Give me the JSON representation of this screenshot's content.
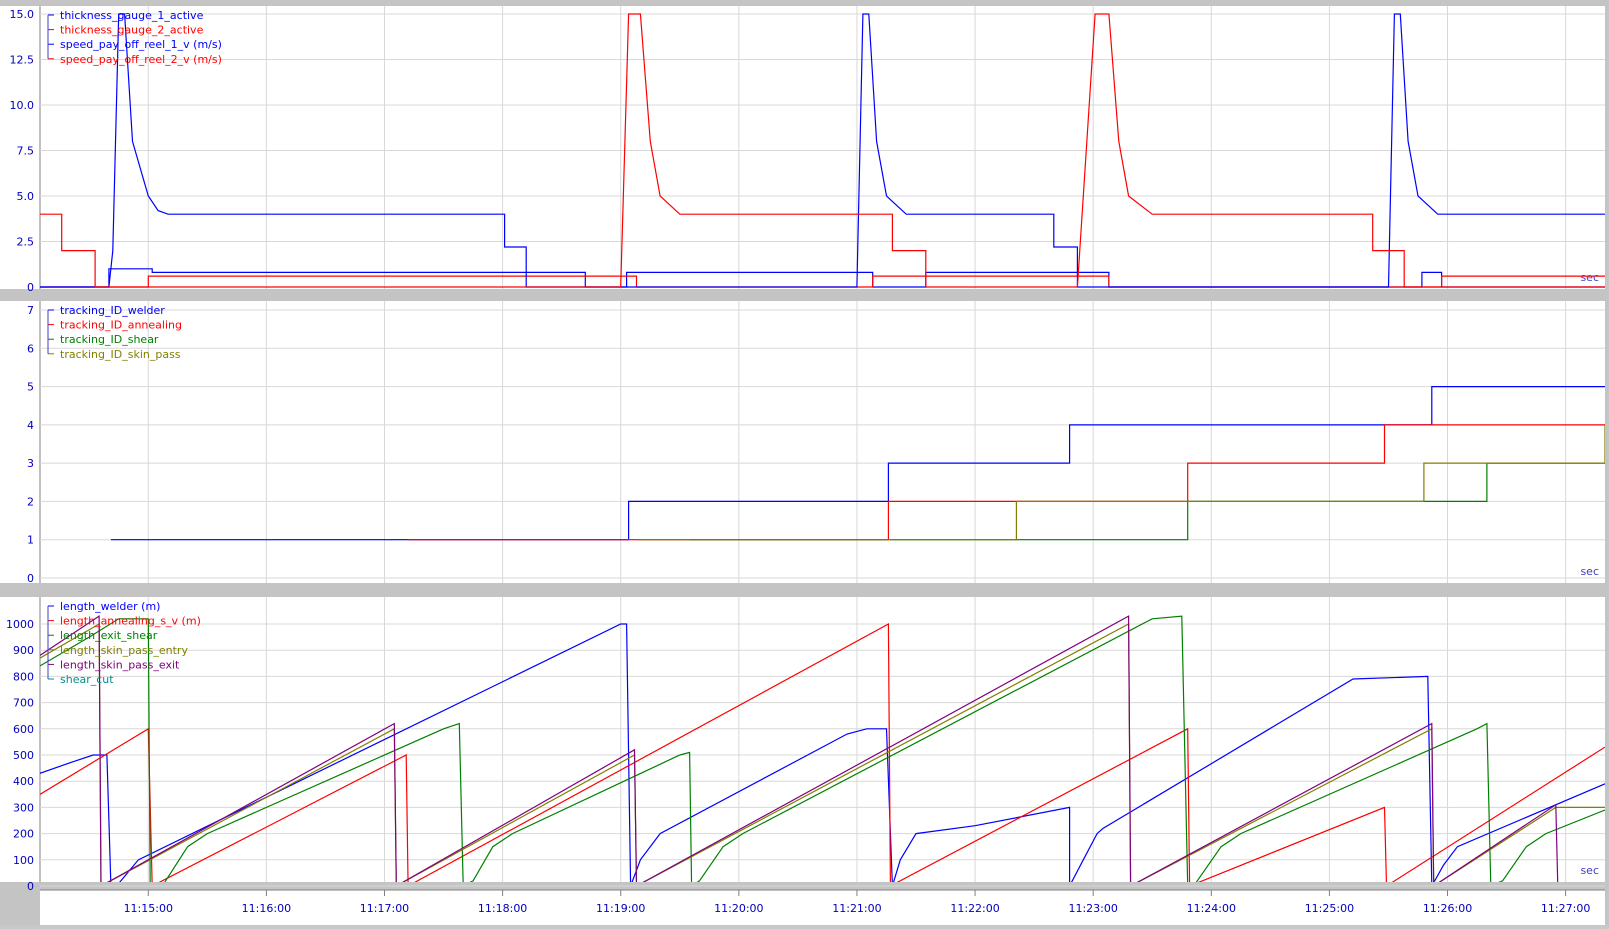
{
  "time_axis": {
    "start": "11:14:05",
    "end": "11:27:20",
    "ticks": [
      "11:15:00",
      "11:16:00",
      "11:17:00",
      "11:18:00",
      "11:19:00",
      "11:20:00",
      "11:21:00",
      "11:22:00",
      "11:23:00",
      "11:24:00",
      "11:25:00",
      "11:26:00",
      "11:27:00"
    ],
    "unit": "sec"
  },
  "chart_data": [
    {
      "type": "line",
      "ylim": [
        0,
        15
      ],
      "yticks": [
        "0",
        "2.5",
        "5.0",
        "7.5",
        "10.0",
        "12.5",
        "15.0"
      ],
      "grid": true,
      "legend_position": "top-left",
      "unit": "sec",
      "series": [
        {
          "name": "thickness_gauge_1_active",
          "color": "#0000ff",
          "step": true,
          "x": [
            "11:14:05",
            "11:14:40",
            "11:14:40",
            "11:15:02",
            "11:15:02",
            "11:18:42",
            "11:18:42",
            "11:19:03",
            "11:19:03",
            "11:21:08",
            "11:21:08",
            "11:21:35",
            "11:21:35",
            "11:23:08",
            "11:23:08",
            "11:25:47",
            "11:25:47",
            "11:25:57",
            "11:25:57",
            "11:27:20"
          ],
          "y": [
            0,
            0,
            1,
            1,
            0.8,
            0.8,
            0,
            0,
            0.8,
            0.8,
            0,
            0,
            0.8,
            0.8,
            0,
            0,
            0.8,
            0.8,
            0,
            0
          ]
        },
        {
          "name": "thickness_gauge_2_active",
          "color": "#ff0000",
          "step": true,
          "x": [
            "11:14:05",
            "11:15:00",
            "11:15:00",
            "11:19:08",
            "11:19:08",
            "11:21:08",
            "11:21:08",
            "11:23:08",
            "11:23:08",
            "11:25:57",
            "11:25:57",
            "11:27:20"
          ],
          "y": [
            0,
            0,
            0.6,
            0.6,
            0,
            0,
            0.6,
            0.6,
            0,
            0,
            0.6,
            0.6
          ]
        },
        {
          "name": "speed_pay_off_reel_1_v (m/s)",
          "color": "#0000ff",
          "x": [
            "11:14:05",
            "11:14:40",
            "11:14:42",
            "11:14:45",
            "11:14:48",
            "11:14:52",
            "11:15:00",
            "11:15:05",
            "11:15:10",
            "11:18:01",
            "11:18:01",
            "11:18:12",
            "11:18:12",
            "11:19:00",
            "11:19:00",
            "11:21:00",
            "11:21:03",
            "11:21:06",
            "11:21:10",
            "11:21:15",
            "11:21:25",
            "11:22:40",
            "11:22:40",
            "11:22:52",
            "11:22:52",
            "11:25:30",
            "11:25:33",
            "11:25:36",
            "11:25:40",
            "11:25:45",
            "11:25:55",
            "11:27:20"
          ],
          "y": [
            0,
            0,
            2,
            15,
            15,
            8,
            5,
            4.2,
            4,
            4,
            2.2,
            2.2,
            0,
            0,
            0,
            0,
            15,
            15,
            8,
            5,
            4,
            4,
            2.2,
            2.2,
            0,
            0,
            15,
            15,
            8,
            5,
            4,
            4
          ]
        },
        {
          "name": "speed_pay_off_reel_2_v (m/s)",
          "color": "#ff0000",
          "x": [
            "11:14:05",
            "11:14:16",
            "11:14:16",
            "11:14:33",
            "11:14:33",
            "11:14:42",
            "11:14:42",
            "11:19:00",
            "11:19:00",
            "11:19:04",
            "11:19:06",
            "11:19:10",
            "11:19:15",
            "11:19:20",
            "11:19:30",
            "11:21:18",
            "11:21:18",
            "11:21:35",
            "11:21:35",
            "11:22:52",
            "11:22:52",
            "11:23:01",
            "11:23:03",
            "11:23:08",
            "11:23:13",
            "11:23:18",
            "11:23:30",
            "11:25:22",
            "11:25:22",
            "11:25:38",
            "11:25:38",
            "11:27:20"
          ],
          "y": [
            4,
            4,
            2,
            2,
            0,
            0,
            0,
            0,
            0,
            15,
            15,
            15,
            8,
            5,
            4,
            4,
            2,
            2,
            0,
            0,
            0,
            15,
            15,
            15,
            8,
            5,
            4,
            4,
            2,
            2,
            0,
            0
          ]
        }
      ]
    },
    {
      "type": "line",
      "ylim": [
        0,
        7
      ],
      "yticks": [
        "0",
        "1",
        "2",
        "3",
        "4",
        "5",
        "6",
        "7"
      ],
      "grid": true,
      "legend_position": "top-left",
      "unit": "sec",
      "series": [
        {
          "name": "tracking_ID_welder",
          "color": "#0000ff",
          "step": true,
          "x": [
            "11:14:41",
            "11:19:04",
            "11:21:16",
            "11:22:48",
            "11:25:52",
            "11:27:20"
          ],
          "y": [
            1,
            2,
            3,
            4,
            5,
            5
          ]
        },
        {
          "name": "tracking_ID_annealing",
          "color": "#ff0000",
          "step": true,
          "x": [
            "11:17:12",
            "11:21:16",
            "11:23:48",
            "11:25:28",
            "11:27:20"
          ],
          "y": [
            1,
            2,
            3,
            4,
            4
          ]
        },
        {
          "name": "tracking_ID_shear",
          "color": "#008000",
          "step": true,
          "x": [
            "11:19:35",
            "11:22:28",
            "11:23:48",
            "11:26:20",
            "11:27:20"
          ],
          "y": [
            1,
            1,
            2,
            3,
            3
          ]
        },
        {
          "name": "tracking_ID_skin_pass",
          "color": "#808000",
          "step": true,
          "x": [
            "11:19:09",
            "11:22:21",
            "11:23:48",
            "11:25:48",
            "11:27:20"
          ],
          "y": [
            1,
            2,
            2,
            3,
            4
          ]
        }
      ]
    },
    {
      "type": "line",
      "ylim": [
        0,
        1000
      ],
      "yticks": [
        "0",
        "100",
        "200",
        "300",
        "400",
        "500",
        "600",
        "700",
        "800",
        "900",
        "1000"
      ],
      "grid": true,
      "legend_position": "top-left",
      "unit": "sec",
      "series": [
        {
          "name": "length_welder (m)",
          "color": "#0000ff",
          "x": [
            "11:14:05",
            "11:14:20",
            "11:14:32",
            "11:14:39",
            "11:14:41",
            "11:14:45",
            "11:14:55",
            "11:19:00",
            "11:19:03",
            "11:19:05",
            "11:19:10",
            "11:19:20",
            "11:20:55",
            "11:21:05",
            "11:21:15",
            "11:21:18",
            "11:21:22",
            "11:21:30",
            "11:22:00",
            "11:22:48",
            "11:22:48",
            "11:22:55",
            "11:23:02",
            "11:23:05",
            "11:25:12",
            "11:25:50",
            "11:25:52",
            "11:25:58",
            "11:26:05",
            "11:27:20"
          ],
          "y": [
            430,
            470,
            500,
            500,
            0,
            10,
            100,
            1000,
            1000,
            0,
            100,
            200,
            580,
            600,
            600,
            0,
            100,
            200,
            230,
            300,
            0,
            100,
            200,
            220,
            790,
            800,
            0,
            80,
            150,
            390
          ]
        },
        {
          "name": "length_annealing_s_v (m)",
          "color": "#ff0000",
          "x": [
            "11:14:05",
            "11:15:00",
            "11:15:02",
            "11:17:11",
            "11:17:12",
            "11:21:16",
            "11:21:17",
            "11:23:48",
            "11:23:49",
            "11:25:28",
            "11:25:29",
            "11:27:20"
          ],
          "y": [
            350,
            600,
            0,
            500,
            0,
            1000,
            0,
            600,
            0,
            300,
            0,
            530
          ]
        },
        {
          "name": "length_exit_shear",
          "color": "#008000",
          "x": [
            "11:14:05",
            "11:14:30",
            "11:14:45",
            "11:15:00",
            "11:15:01",
            "11:15:08",
            "11:15:20",
            "11:15:30",
            "11:17:30",
            "11:17:38",
            "11:17:40",
            "11:17:45",
            "11:17:55",
            "11:18:05",
            "11:19:30",
            "11:19:35",
            "11:19:36",
            "11:19:40",
            "11:19:52",
            "11:20:02",
            "11:23:30",
            "11:23:45",
            "11:23:48",
            "11:23:52",
            "11:24:05",
            "11:24:15",
            "11:26:15",
            "11:26:20",
            "11:26:22",
            "11:26:28",
            "11:26:40",
            "11:26:50",
            "11:27:20"
          ],
          "y": [
            840,
            950,
            1020,
            1020,
            0,
            10,
            150,
            200,
            600,
            620,
            0,
            20,
            150,
            200,
            500,
            510,
            0,
            20,
            150,
            200,
            1020,
            1030,
            0,
            10,
            150,
            200,
            600,
            620,
            0,
            20,
            150,
            200,
            290
          ]
        },
        {
          "name": "length_skin_pass_entry",
          "color": "#808000",
          "x": [
            "11:14:05",
            "11:14:35",
            "11:14:36",
            "11:17:05",
            "11:17:06",
            "11:19:07",
            "11:19:08",
            "11:23:18",
            "11:23:19",
            "11:25:52",
            "11:25:53",
            "11:26:55",
            "11:27:20"
          ],
          "y": [
            870,
            1000,
            0,
            600,
            0,
            500,
            0,
            1000,
            0,
            600,
            0,
            300,
            300
          ]
        },
        {
          "name": "length_skin_pass_exit",
          "color": "#800080",
          "x": [
            "11:14:05",
            "11:14:35",
            "11:14:36",
            "11:17:05",
            "11:17:06",
            "11:19:07",
            "11:19:08",
            "11:23:18",
            "11:23:19",
            "11:25:52",
            "11:25:53",
            "11:26:55",
            "11:26:56"
          ],
          "y": [
            880,
            1030,
            0,
            620,
            0,
            520,
            0,
            1030,
            0,
            620,
            0,
            310,
            0
          ]
        },
        {
          "name": "shear_cut",
          "color": "#009090",
          "x": [
            "11:14:05",
            "11:14:58",
            "11:15:10",
            "11:17:32",
            "11:17:44",
            "11:19:32",
            "11:19:44",
            "11:23:44",
            "11:23:56",
            "11:26:16",
            "11:26:28",
            "11:27:20"
          ],
          "y": [
            0,
            1,
            1,
            1,
            1,
            1,
            1,
            1,
            1,
            1,
            1,
            0
          ]
        }
      ]
    }
  ]
}
